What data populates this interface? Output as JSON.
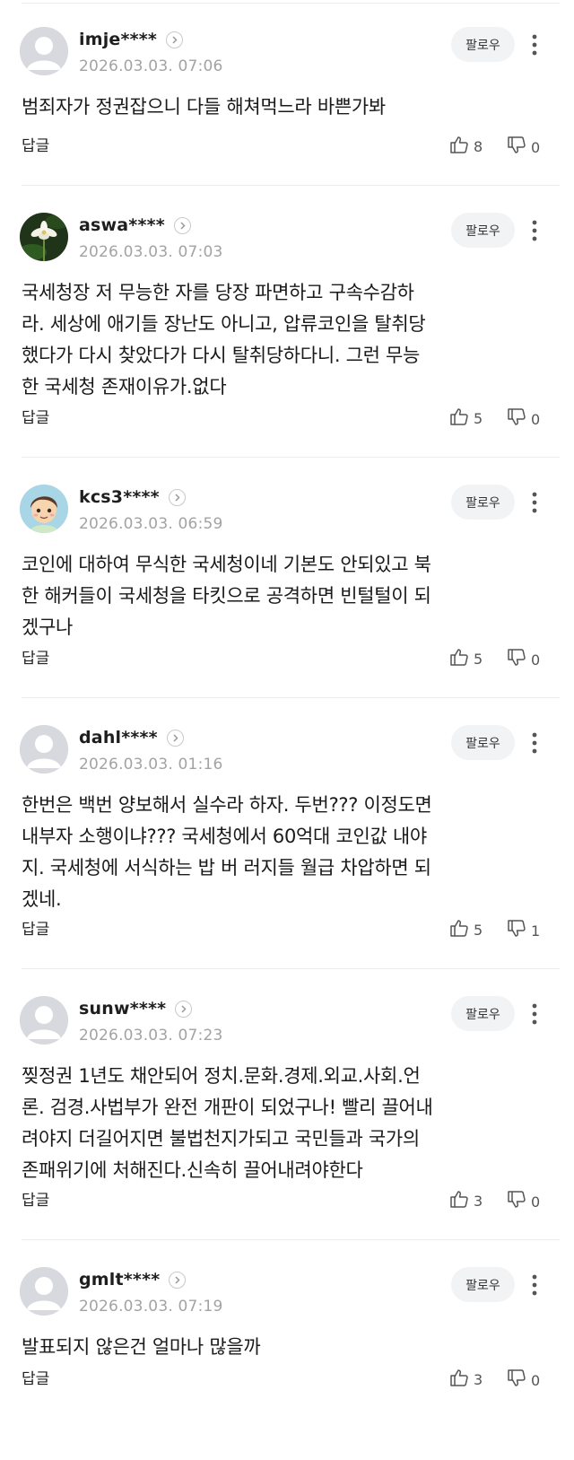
{
  "comments": [
    {
      "username": "imje****",
      "timestamp": "2026.03.03. 07:06",
      "follow_label": "팔로우",
      "text": "범죄자가 정권잡으니 다들 해쳐먹느라 바쁜가봐",
      "reply_label": "답글",
      "likes": "8",
      "dislikes": "0",
      "avatar_icon": "default-avatar-icon"
    },
    {
      "username": "aswa****",
      "timestamp": "2026.03.03. 07:03",
      "follow_label": "팔로우",
      "text": "국세청장 저 무능한 자를 당장 파면하고 구속수감하\n라. 세상에 애기들 장난도 아니고, 압류코인을 탈취당\n했다가 다시 찾았다가 다시 탈취당하다니. 그런 무능\n한 국세청 존재이유가.없다",
      "reply_label": "답글",
      "likes": "5",
      "dislikes": "0",
      "avatar_icon": "flower-photo-avatar"
    },
    {
      "username": "kcs3****",
      "timestamp": "2026.03.03. 06:59",
      "follow_label": "팔로우",
      "text": "코인에 대하여 무식한 국세청이네 기본도 안되있고 북\n한 해커들이 국세청을 타킷으로 공격하면 빈털털이 되\n겠구나",
      "reply_label": "답글",
      "likes": "5",
      "dislikes": "0",
      "avatar_icon": "cartoon-boy-avatar"
    },
    {
      "username": "dahl****",
      "timestamp": "2026.03.03. 01:16",
      "follow_label": "팔로우",
      "text": "한번은 백번 양보해서 실수라 하자. 두번??? 이정도면\n내부자 소행이냐??? 국세청에서 60억대 코인값 내야\n지. 국세청에 서식하는 밥 버 러지들 월급 차압하면 되\n겠네.",
      "reply_label": "답글",
      "likes": "5",
      "dislikes": "1",
      "avatar_icon": "default-avatar-icon"
    },
    {
      "username": "sunw****",
      "timestamp": "2026.03.03. 07:23",
      "follow_label": "팔로우",
      "text": "찢정권 1년도 채안되어 정치.문화.경제.외교.사회.언\n론. 검경.사법부가 완전 개판이 되었구나! 빨리 끌어내\n려야지 더길어지면 불법천지가되고 국민들과 국가의\n존패위기에 처해진다.신속히 끌어내려야한다",
      "reply_label": "답글",
      "likes": "3",
      "dislikes": "0",
      "avatar_icon": "default-avatar-icon"
    },
    {
      "username": "gmlt****",
      "timestamp": "2026.03.03. 07:19",
      "follow_label": "팔로우",
      "text": "발표되지 않은건 얼마나 많을까",
      "reply_label": "답글",
      "likes": "3",
      "dislikes": "0",
      "avatar_icon": "default-avatar-icon"
    }
  ]
}
